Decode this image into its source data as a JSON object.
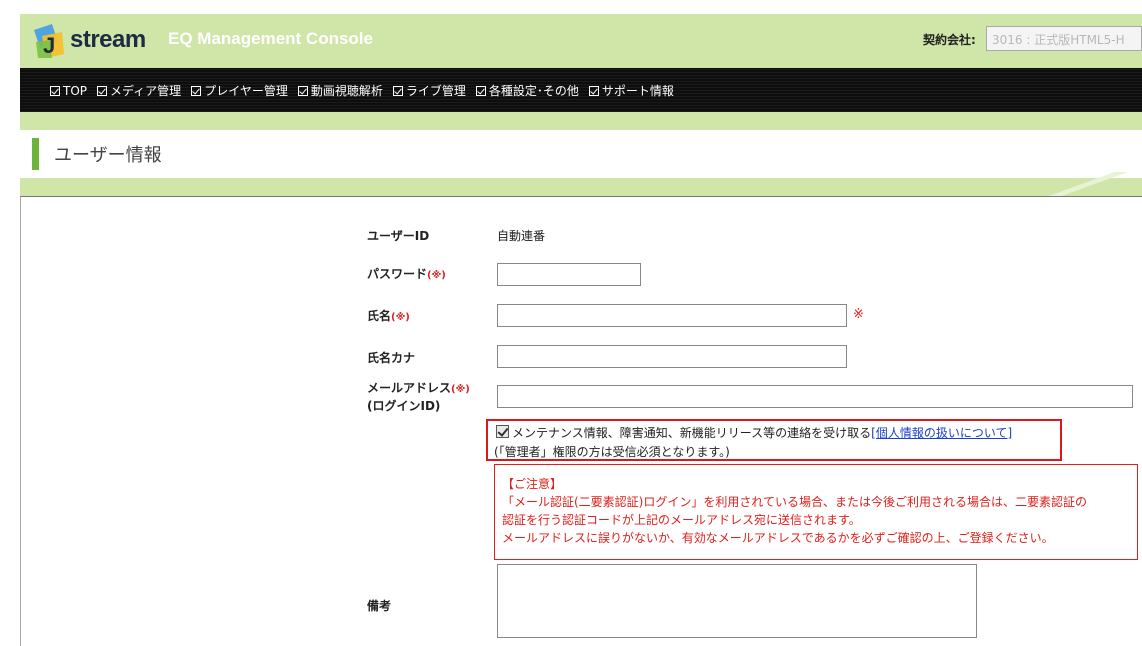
{
  "header": {
    "logo_text": "stream",
    "console_title": "EQ Management Console",
    "company_label": "契約会社:",
    "company_value": "3016 : 正式版HTML5-H"
  },
  "nav": {
    "items": [
      {
        "label": "TOP"
      },
      {
        "label": "メディア管理"
      },
      {
        "label": "プレイヤー管理"
      },
      {
        "label": "動画視聴解析"
      },
      {
        "label": "ライブ管理"
      },
      {
        "label": "各種設定･その他"
      },
      {
        "label": "サポート情報"
      }
    ]
  },
  "page": {
    "title": "ユーザー情報"
  },
  "form": {
    "user_id_label": "ユーザーID",
    "user_id_value": "自動連番",
    "password_label": "パスワード",
    "name_label": "氏名",
    "name_kana_label": "氏名カナ",
    "email_label": "メールアドレス",
    "email_label_sub": "(ログインID)",
    "required_mark": "(※)",
    "required_symbol": "※",
    "remarks_label": "備考",
    "password_value": "",
    "name_value": "",
    "name_kana_value": "",
    "email_value": "",
    "remarks_value": ""
  },
  "notice": {
    "checkbox_checked": true,
    "checkbox_text": "メンテナンス情報、障害通知、新機能リリース等の連絡を受け取る",
    "link_text": "[個人情報の扱いについて]",
    "sub_text": "(「管理者」権限の方は受信必須となります。)"
  },
  "warning": {
    "title": "【ご注意】",
    "line1": "「メール認証(二要素認証)ログイン」を利用されている場合、または今後ご利用される場合は、二要素認証の",
    "line2": "認証を行う認証コードが上記のメールアドレス宛に送信されます。",
    "line3": "メールアドレスに誤りがないか、有効なメールアドレスであるかを必ずご確認の上、ご登録ください。"
  },
  "colors": {
    "brand_green": "#cfe6a8",
    "accent_green": "#6fb43a",
    "required_red": "#e0201c",
    "link_blue": "#1a3fcc"
  }
}
